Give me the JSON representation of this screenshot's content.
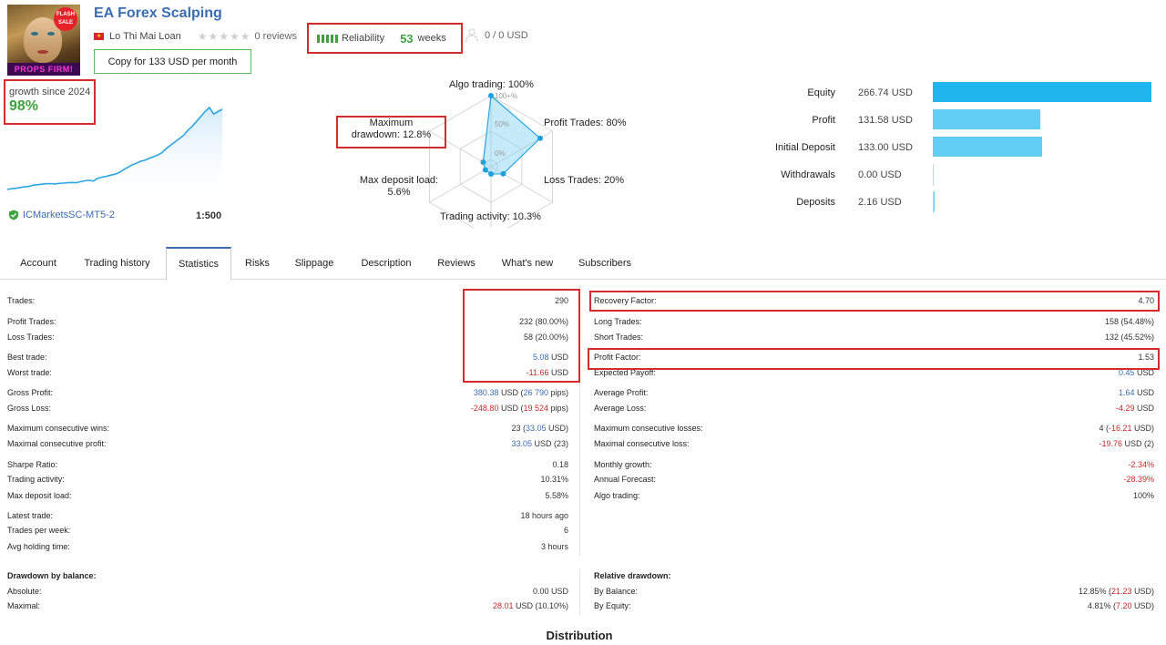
{
  "header": {
    "title": "EA Forex Scalping",
    "author": "Lo Thi Mai Loan",
    "reviews": "0 reviews",
    "reliability_label": "Reliability",
    "weeks_value": "53",
    "weeks_label": "weeks",
    "subscribers": "0 / 0 USD",
    "copy_button": "Copy for 133 USD per month",
    "avatar_text": "PROPS FIRM!",
    "avatar_badge": "FLASH SALE",
    "rating_stars": 0
  },
  "growth": {
    "label": "growth since 2024",
    "value": "98%",
    "broker": "ICMarketsSC-MT5-2",
    "leverage": "1:500"
  },
  "radar": {
    "algo_trading": "Algo trading: 100%",
    "profit_trades": "Profit Trades: 80%",
    "loss_trades": "Loss Trades: 20%",
    "trading_activity": "Trading activity: 10.3%",
    "max_deposit_load_1": "Max deposit load:",
    "max_deposit_load_2": "5.6%",
    "max_drawdown_1": "Maximum",
    "max_drawdown_2": "drawdown: 12.8%",
    "grid_100": "100+%",
    "grid_50": "50%",
    "grid_0": "0%",
    "values": {
      "algo_trading": 1.0,
      "profit_trades": 0.8,
      "loss_trades": 0.2,
      "trading_activity": 0.103,
      "max_deposit_load": 0.056,
      "max_drawdown": 0.128
    }
  },
  "balance": [
    {
      "label": "Equity",
      "value": "266.74 USD",
      "amount": 266.74,
      "color": "#1fb6ee"
    },
    {
      "label": "Profit",
      "value": "131.58 USD",
      "amount": 131.58,
      "color": "#62cdf3"
    },
    {
      "label": "Initial Deposit",
      "value": "133.00 USD",
      "amount": 133.0,
      "color": "#62cdf3"
    },
    {
      "label": "Withdrawals",
      "value": "0.00 USD",
      "amount": 0.0,
      "color": "#62cdf3"
    },
    {
      "label": "Deposits",
      "value": "2.16 USD",
      "amount": 2.16,
      "color": "#62cdf3"
    }
  ],
  "tabs": [
    "Account",
    "Trading history",
    "Statistics",
    "Risks",
    "Slippage",
    "Description",
    "Reviews",
    "What's new",
    "Subscribers"
  ],
  "stats": {
    "left": [
      {
        "k": "Trades:",
        "v": "290"
      },
      {
        "k": "Profit Trades:",
        "v": "232 (80.00%)"
      },
      {
        "k": "Loss Trades:",
        "v": "58 (20.00%)"
      },
      {
        "k": "Best trade:",
        "v1": "5.08",
        "v2": " USD",
        "c": "blue"
      },
      {
        "k": "Worst trade:",
        "v1": "-11.66",
        "v2": " USD",
        "c": "red"
      },
      {
        "k": "Gross Profit:",
        "v1": "380.38",
        "v2": " USD (",
        "v3": "26 790",
        "v4": " pips)",
        "c": "blue"
      },
      {
        "k": "Gross Loss:",
        "v1": "-248.80",
        "v2": " USD (",
        "v3": "19 524",
        "v4": " pips)",
        "c": "red"
      },
      {
        "k": "Maximum consecutive wins:",
        "v1": "23",
        "v2": " (",
        "v3": "33.05",
        "v4": " USD)",
        "c2": "blue"
      },
      {
        "k": "Maximal consecutive profit:",
        "v1": "33.05",
        "v2": " USD (23)",
        "c": "blue"
      },
      {
        "k": "Sharpe Ratio:",
        "v": "0.18"
      },
      {
        "k": "Trading activity:",
        "v": "10.31%"
      },
      {
        "k": "Max deposit load:",
        "v": "5.58%"
      },
      {
        "k": "Latest trade:",
        "v": "18 hours ago"
      },
      {
        "k": "Trades per week:",
        "v": "6"
      },
      {
        "k": "Avg holding time:",
        "v": "3 hours"
      }
    ],
    "right": [
      {
        "k": "Recovery Factor:",
        "v": "4.70"
      },
      {
        "k": "Long Trades:",
        "v": "158 (54.48%)"
      },
      {
        "k": "Short Trades:",
        "v": "132 (45.52%)"
      },
      {
        "k": "Profit Factor:",
        "v": "1.53"
      },
      {
        "k": "Expected Payoff:",
        "v1": "0.45",
        "v2": " USD",
        "c": "blue"
      },
      {
        "k": "Average Profit:",
        "v1": "1.64",
        "v2": " USD",
        "c": "blue"
      },
      {
        "k": "Average Loss:",
        "v1": "-4.29",
        "v2": " USD",
        "c": "red"
      },
      {
        "k": "Maximum consecutive losses:",
        "v1": "4",
        "v2": " (",
        "v3": "-16.21",
        "v4": " USD)",
        "c2": "red"
      },
      {
        "k": "Maximal consecutive loss:",
        "v1": "-19.76",
        "v2": " USD (2)",
        "c": "red"
      },
      {
        "k": "Monthly growth:",
        "v": "-2.34%",
        "c": "red"
      },
      {
        "k": "Annual Forecast:",
        "v": "-28.39%",
        "c": "red"
      },
      {
        "k": "Algo trading:",
        "v": "100%"
      }
    ]
  },
  "drawdown": {
    "left_title": "Drawdown by balance:",
    "left": [
      {
        "k": "Absolute:",
        "v": "0.00 USD"
      },
      {
        "k": "Maximal:",
        "v1": "28.01",
        "v2": " USD (10.10%)",
        "c": "red"
      }
    ],
    "right_title": "Relative drawdown:",
    "right": [
      {
        "k": "By Balance:",
        "v1": "12.85% (",
        "v2": "21.23",
        "v3": " USD)",
        "c2": "red"
      },
      {
        "k": "By Equity:",
        "v1": "4.81% (",
        "v2": "7.20",
        "v3": " USD)",
        "c2": "red"
      }
    ]
  },
  "distribution_title": "Distribution",
  "growth_series": [
    0,
    1,
    1.5,
    2.5,
    3.2,
    3.8,
    5.2,
    5.8,
    6.5,
    7,
    7.2,
    6.8,
    7.5,
    7.8,
    8.2,
    8.5,
    8.2,
    9.5,
    10.5,
    11.2,
    10.2,
    13.5,
    15,
    16,
    17.5,
    18.5,
    20.5,
    24,
    27,
    30,
    32,
    34.5,
    35.5,
    38,
    40,
    42,
    45,
    50,
    54,
    58,
    62,
    66,
    72,
    77,
    83,
    89,
    95,
    100,
    92,
    95,
    98
  ]
}
